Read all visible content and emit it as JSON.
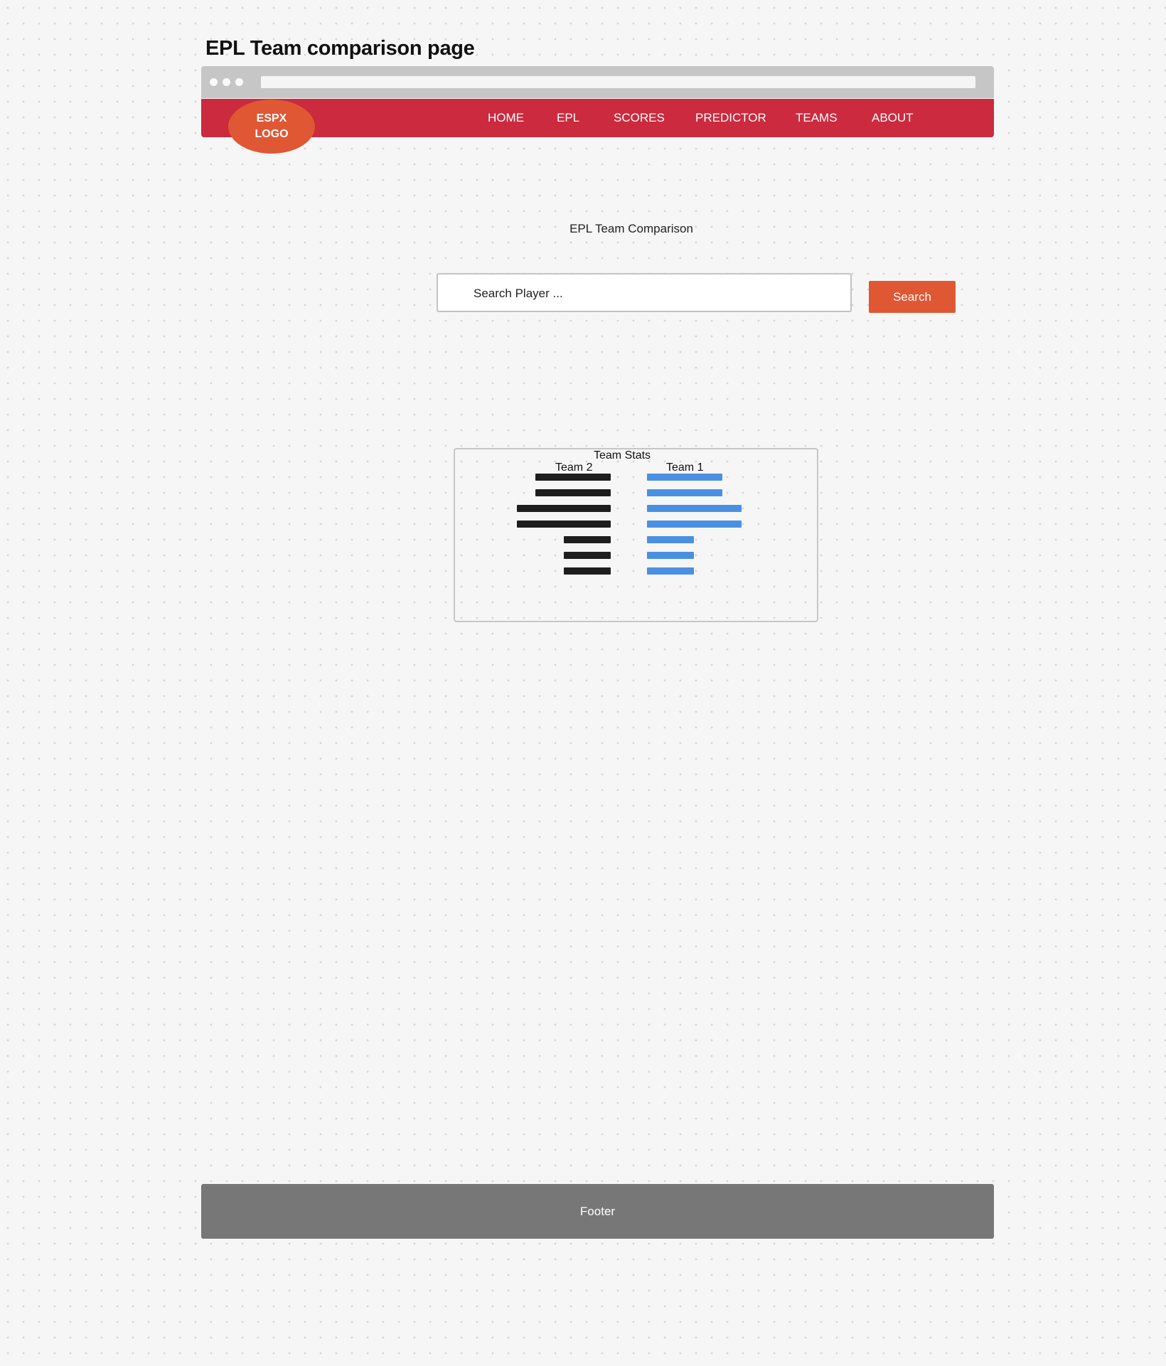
{
  "page_heading": "EPL Team comparison page",
  "logo": {
    "text": "ESPX LOGO"
  },
  "nav": {
    "items": [
      {
        "label": "HOME"
      },
      {
        "label": "EPL"
      },
      {
        "label": "SCORES"
      },
      {
        "label": "PREDICTOR"
      },
      {
        "label": "TEAMS"
      },
      {
        "label": "ABOUT"
      }
    ]
  },
  "main": {
    "title": "EPL Team Comparison",
    "search": {
      "placeholder": "Search Player ...",
      "value": "",
      "button_label": "Search"
    }
  },
  "stats": {
    "title": "Team Stats",
    "team_left_label": "Team 2",
    "team_right_label": "Team 1"
  },
  "colors": {
    "nav_bg": "#cc2a3e",
    "accent": "#e05734",
    "team2_bar": "#1e1e1e",
    "team1_bar": "#4a90e2",
    "footer_bg": "#777777"
  },
  "chart_data": {
    "type": "bar",
    "title": "Team Stats",
    "orientation": "horizontal-butterfly",
    "series": [
      {
        "name": "Team 2",
        "values": [
          4,
          4,
          5,
          5,
          2.5,
          2.5,
          2.5
        ]
      },
      {
        "name": "Team 1",
        "values": [
          4,
          4,
          5,
          5,
          2.5,
          2.5,
          2.5
        ]
      }
    ]
  },
  "footer": {
    "text": "Footer"
  }
}
